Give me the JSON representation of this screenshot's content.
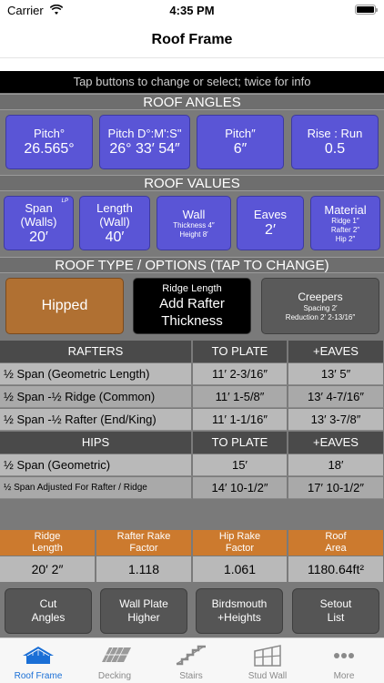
{
  "status": {
    "carrier": "Carrier",
    "time": "4:35 PM"
  },
  "nav": {
    "title": "Roof Frame"
  },
  "hint": "Tap buttons to change or select; twice for info",
  "roof_angles": {
    "header": "ROOF ANGLES",
    "buttons": [
      {
        "label": "Pitch°",
        "value": "26.565°"
      },
      {
        "label": "Pitch D°:M':S\"",
        "value": "26° 33′ 54″"
      },
      {
        "label": "Pitch″",
        "value": "6″"
      },
      {
        "label": "Rise : Run",
        "value": "0.5"
      }
    ]
  },
  "roof_values": {
    "header": "ROOF VALUES",
    "span": {
      "label1": "Span",
      "label2": "(Walls)",
      "value": "20′",
      "badge": "LP"
    },
    "length": {
      "label1": "Length",
      "label2": "(Wall)",
      "value": "40′"
    },
    "wall": {
      "label": "Wall",
      "sub1": "Thickness 4″",
      "sub2": "Height 8′"
    },
    "eaves": {
      "label": "Eaves",
      "value": "2′"
    },
    "material": {
      "label": "Material",
      "sub1": "Ridge 1″",
      "sub2": "Rafter 2″",
      "sub3": "Hip 2″"
    }
  },
  "roof_type": {
    "header": "ROOF TYPE / OPTIONS (TAP TO CHANGE)",
    "hipped": "Hipped",
    "rafter": {
      "small": "Ridge Length",
      "line1": "Add Rafter",
      "line2": "Thickness"
    },
    "creepers": {
      "label": "Creepers",
      "sub1": "Spacing 2′",
      "sub2": "Reduction 2′ 2-13/16″"
    }
  },
  "rafters": {
    "headers": [
      "RAFTERS",
      "TO PLATE",
      "+EAVES"
    ],
    "rows": [
      {
        "name": "½ Span (Geometric Length)",
        "plate": "11′ 2-3/16″",
        "eaves": "13′ 5″"
      },
      {
        "name": "½ Span -½ Ridge (Common)",
        "plate": "11′ 1-5/8″",
        "eaves": "13′ 4-7/16″"
      },
      {
        "name": "½ Span -½ Rafter (End/King)",
        "plate": "11′ 1-1/16″",
        "eaves": "13′ 3-7/8″"
      }
    ]
  },
  "hips": {
    "headers": [
      "HIPS",
      "TO PLATE",
      "+EAVES"
    ],
    "rows": [
      {
        "name": "½ Span (Geometric)",
        "plate": "15′",
        "eaves": "18′"
      },
      {
        "name": "½ Span Adjusted For Rafter / Ridge",
        "plate": "14′ 10-1/2″",
        "eaves": "17′ 10-1/2″"
      }
    ]
  },
  "summary": [
    {
      "l1": "Ridge",
      "l2": "Length",
      "value": "20′ 2″"
    },
    {
      "l1": "Rafter Rake",
      "l2": "Factor",
      "value": "1.118"
    },
    {
      "l1": "Hip Rake",
      "l2": "Factor",
      "value": "1.061"
    },
    {
      "l1": "Roof",
      "l2": "Area",
      "value": "1180.64ft²"
    }
  ],
  "actions": [
    {
      "l1": "Cut",
      "l2": "Angles"
    },
    {
      "l1": "Wall Plate",
      "l2": "Higher"
    },
    {
      "l1": "Birdsmouth",
      "l2": "+Heights"
    },
    {
      "l1": "Setout",
      "l2": "List"
    }
  ],
  "tabs": [
    {
      "label": "Roof Frame",
      "icon": "roof-frame-icon"
    },
    {
      "label": "Decking",
      "icon": "decking-icon"
    },
    {
      "label": "Stairs",
      "icon": "stairs-icon"
    },
    {
      "label": "Stud Wall",
      "icon": "stud-wall-icon"
    },
    {
      "label": "More",
      "icon": "more-icon"
    }
  ],
  "colors": {
    "accent": "#5a55d6",
    "orange": "#cc7a2e",
    "hipped": "#b07032",
    "tab_active": "#1a6fd6"
  }
}
